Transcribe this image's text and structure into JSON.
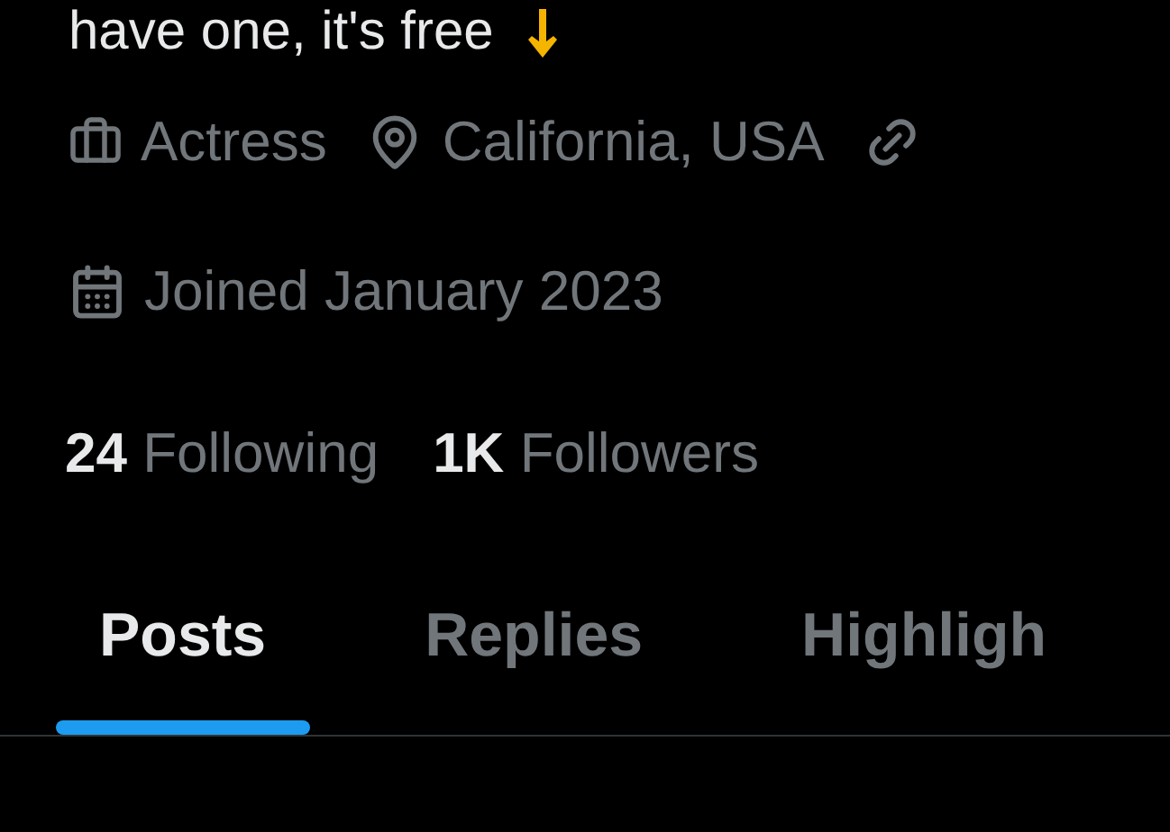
{
  "bio": {
    "text": "have one, it's free"
  },
  "profile_meta": [
    {
      "kind": "work",
      "label": "Actress"
    },
    {
      "kind": "location",
      "label": "California, USA"
    },
    {
      "kind": "link"
    }
  ],
  "joined": {
    "label": "Joined January 2023"
  },
  "stats": [
    {
      "count": "24",
      "label": "Following"
    },
    {
      "count": "1K",
      "label": "Followers"
    }
  ],
  "tabs": [
    {
      "label": "Posts",
      "selected": true
    },
    {
      "label": "Replies",
      "selected": false
    },
    {
      "label": "Highligh",
      "selected": false
    }
  ]
}
